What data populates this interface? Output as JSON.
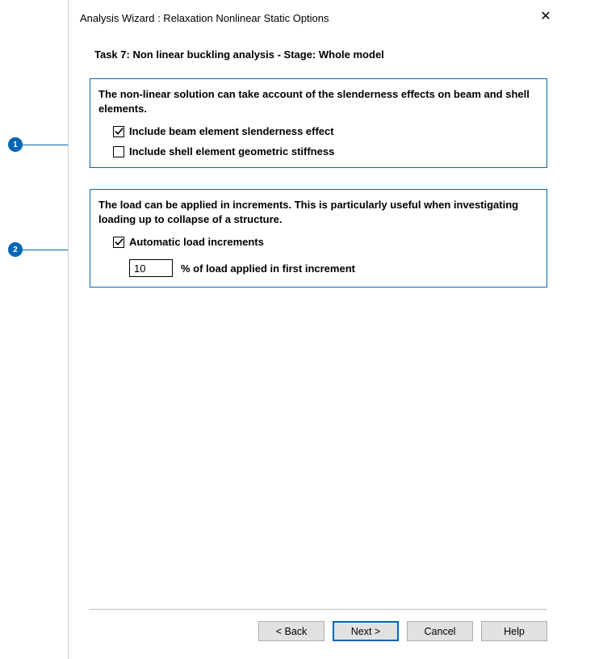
{
  "dialog": {
    "title": "Analysis Wizard : Relaxation Nonlinear Static Options",
    "task_line": "Task 7: Non linear buckling analysis   -  Stage: Whole model"
  },
  "section1": {
    "description": "The non-linear solution can take account of the slenderness effects on beam and shell elements.",
    "checkbox1_label": "Include beam element slenderness effect",
    "checkbox1_checked": true,
    "checkbox2_label": "Include shell element geometric stiffness",
    "checkbox2_checked": false
  },
  "section2": {
    "description": "The load can be applied in increments. This is particularly useful when investigating loading up to collapse of a structure.",
    "checkbox_label": "Automatic load increments",
    "checkbox_checked": true,
    "input_value": "10",
    "input_suffix": "% of load applied in first increment"
  },
  "buttons": {
    "back": "< Back",
    "next": "Next >",
    "cancel": "Cancel",
    "help": "Help"
  },
  "callouts": {
    "c1": "1",
    "c2": "2"
  }
}
